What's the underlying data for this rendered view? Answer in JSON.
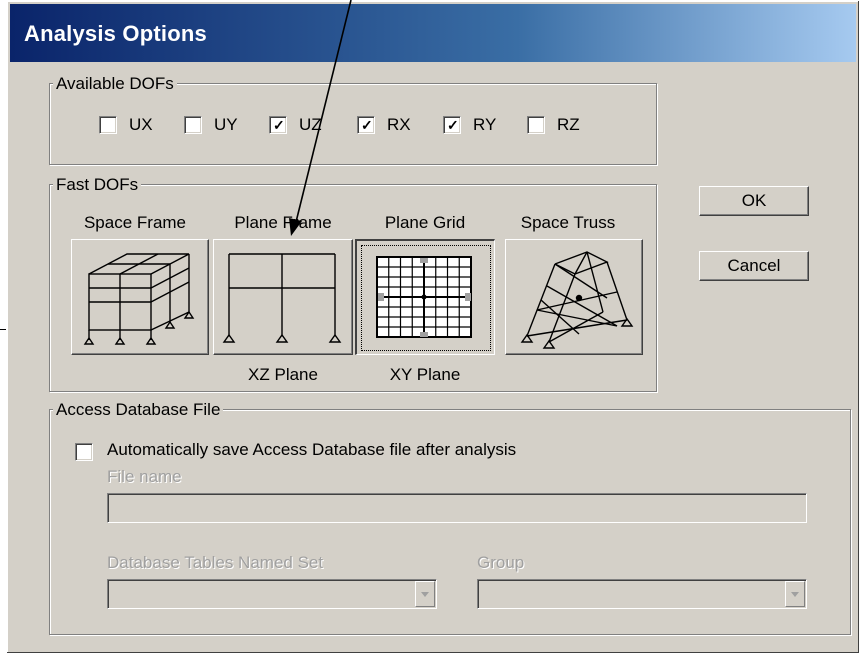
{
  "window": {
    "title": "Analysis Options"
  },
  "available_dofs": {
    "label": "Available DOFs",
    "items": [
      {
        "label": "UX",
        "checked": false
      },
      {
        "label": "UY",
        "checked": false
      },
      {
        "label": "UZ",
        "checked": true
      },
      {
        "label": "RX",
        "checked": true
      },
      {
        "label": "RY",
        "checked": true
      },
      {
        "label": "RZ",
        "checked": false
      }
    ]
  },
  "fast_dofs": {
    "label": "Fast DOFs",
    "options": [
      {
        "label": "Space Frame",
        "sublabel": "",
        "icon": "space-frame-icon",
        "selected": false
      },
      {
        "label": "Plane Frame",
        "sublabel": "XZ Plane",
        "icon": "plane-frame-icon",
        "selected": false
      },
      {
        "label": "Plane Grid",
        "sublabel": "XY Plane",
        "icon": "plane-grid-icon",
        "selected": true
      },
      {
        "label": "Space Truss",
        "sublabel": "",
        "icon": "space-truss-icon",
        "selected": false
      }
    ]
  },
  "buttons": {
    "ok": "OK",
    "cancel": "Cancel"
  },
  "access_db": {
    "label": "Access Database File",
    "auto_save_label": "Automatically save Access Database file after analysis",
    "auto_save_checked": false,
    "file_name_label": "File name",
    "file_name_value": "",
    "tables_set_label": "Database Tables Named Set",
    "tables_set_value": "",
    "group_label": "Group",
    "group_value": ""
  },
  "colors": {
    "title_start": "#0a246a",
    "title_end": "#a6caf0",
    "face": "#d4d0c8"
  }
}
